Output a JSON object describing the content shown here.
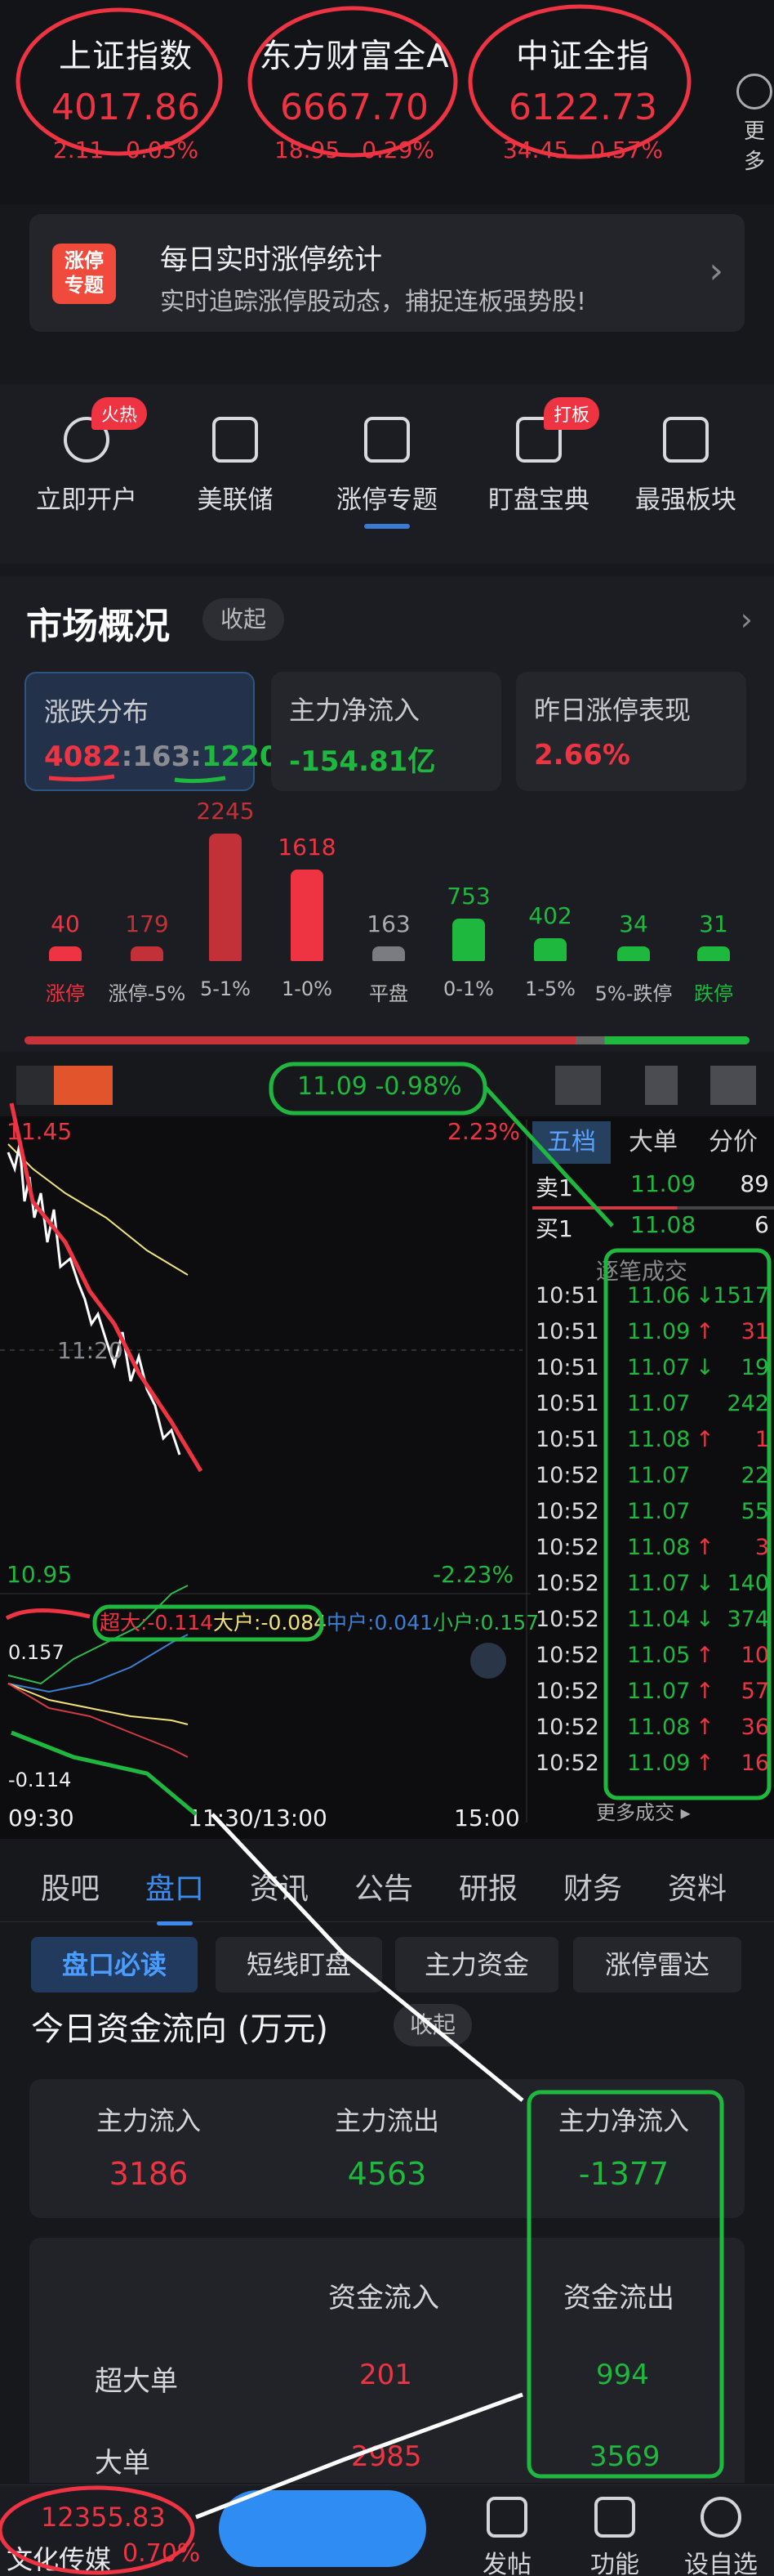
{
  "indices": [
    {
      "name": "上证指数",
      "value": "4017.86",
      "change": "2.11",
      "pct": "0.05%"
    },
    {
      "name": "东方财富全A",
      "value": "6667.70",
      "change": "18.95",
      "pct": "0.29%"
    },
    {
      "name": "中证全指",
      "value": "6122.73",
      "change": "34.45",
      "pct": "0.57%"
    }
  ],
  "more_label": "更多",
  "banner": {
    "logo_line1": "涨停",
    "logo_line2": "专题",
    "title": "每日实时涨停统计",
    "subtitle": "实时追踪涨停股动态，捕捉连板强势股!"
  },
  "shortcuts": [
    {
      "label": "立即开户",
      "badge": "火热",
      "icon": "user-add-icon"
    },
    {
      "label": "美联储",
      "badge": "",
      "icon": "bank-icon"
    },
    {
      "label": "涨停专题",
      "badge": "",
      "icon": "trend-up-icon"
    },
    {
      "label": "盯盘宝典",
      "badge": "打板",
      "icon": "candlestick-icon"
    },
    {
      "label": "最强板块",
      "badge": "",
      "icon": "grid-chart-icon"
    }
  ],
  "market": {
    "title": "市场概况",
    "collapse": "收起",
    "cards": [
      {
        "title": "涨跌分布",
        "up": "4082",
        "flat": "163",
        "down": "1220"
      },
      {
        "title": "主力净流入",
        "value": "-154.81亿"
      },
      {
        "title": "昨日涨停表现",
        "value": "2.66%"
      }
    ],
    "distribution": [
      {
        "label": "涨停",
        "value": 40,
        "color": "#ee3442"
      },
      {
        "label": "涨停-5%",
        "value": 179,
        "color": "#c23038"
      },
      {
        "label": "5-1%",
        "value": 2245,
        "color": "#c23038"
      },
      {
        "label": "1-0%",
        "value": 1618,
        "color": "#ee3442"
      },
      {
        "label": "平盘",
        "value": 163,
        "color": "#7a7c82"
      },
      {
        "label": "0-1%",
        "value": 753,
        "color": "#1fb83f"
      },
      {
        "label": "1-5%",
        "value": 402,
        "color": "#1fb83f"
      },
      {
        "label": "5%-跌停",
        "value": 34,
        "color": "#1fb83f"
      },
      {
        "label": "跌停",
        "value": 31,
        "color": "#1fb83f"
      }
    ]
  },
  "stock": {
    "price": "11.09",
    "pct": "-0.98%",
    "axis": {
      "high": "11.45",
      "mid": "11:20",
      "low": "10.95",
      "high_pct": "2.23%",
      "low_pct": "-2.23%"
    },
    "flow_labels": {
      "big": "超大:-0.114",
      "large": "大户:-0.084",
      "mid": "中户:0.041",
      "small": "小户:0.157",
      "top": "0.157",
      "bottom": "-0.114"
    },
    "time_axis": [
      "09:30",
      "11:30/13:00",
      "15:00"
    ],
    "panel_tabs": [
      "五档",
      "大单",
      "分价"
    ],
    "orderbook": [
      {
        "side": "卖1",
        "price": "11.09",
        "vol": "89"
      },
      {
        "side": "买1",
        "price": "11.08",
        "vol": "6"
      }
    ],
    "trades_title": "逐笔成交",
    "trades": [
      {
        "time": "10:51",
        "price": "11.06",
        "dir": "↓",
        "vol": "1517",
        "c": "g"
      },
      {
        "time": "10:51",
        "price": "11.09",
        "dir": "↑",
        "vol": "31",
        "c": "r"
      },
      {
        "time": "10:51",
        "price": "11.07",
        "dir": "↓",
        "vol": "19",
        "c": "g"
      },
      {
        "time": "10:51",
        "price": "11.07",
        "dir": "",
        "vol": "242",
        "c": "g"
      },
      {
        "time": "10:51",
        "price": "11.08",
        "dir": "↑",
        "vol": "1",
        "c": "r"
      },
      {
        "time": "10:52",
        "price": "11.07",
        "dir": "",
        "vol": "22",
        "c": "g"
      },
      {
        "time": "10:52",
        "price": "11.07",
        "dir": "",
        "vol": "55",
        "c": "g"
      },
      {
        "time": "10:52",
        "price": "11.08",
        "dir": "↑",
        "vol": "3",
        "c": "r"
      },
      {
        "time": "10:52",
        "price": "11.07",
        "dir": "↓",
        "vol": "140",
        "c": "g"
      },
      {
        "time": "10:52",
        "price": "11.04",
        "dir": "↓",
        "vol": "374",
        "c": "g"
      },
      {
        "time": "10:52",
        "price": "11.05",
        "dir": "↑",
        "vol": "10",
        "c": "r"
      },
      {
        "time": "10:52",
        "price": "11.07",
        "dir": "↑",
        "vol": "57",
        "c": "r"
      },
      {
        "time": "10:52",
        "price": "11.08",
        "dir": "↑",
        "vol": "36",
        "c": "r"
      },
      {
        "time": "10:52",
        "price": "11.09",
        "dir": "↑",
        "vol": "16",
        "c": "r"
      }
    ],
    "more_trades": "更多成交"
  },
  "tabs": [
    "股吧",
    "盘口",
    "资讯",
    "公告",
    "研报",
    "财务",
    "资料"
  ],
  "chips": [
    "盘口必读",
    "短线盯盘",
    "主力资金",
    "涨停雷达"
  ],
  "fundflow": {
    "title": "今日资金流向 (万元)",
    "collapse": "收起",
    "summary": [
      {
        "label": "主力流入",
        "value": "3186"
      },
      {
        "label": "主力流出",
        "value": "4563"
      },
      {
        "label": "主力净流入",
        "value": "-1377"
      }
    ],
    "headers": [
      "资金流入",
      "资金流出"
    ],
    "rows": [
      {
        "label": "超大单",
        "in": "201",
        "out": "994"
      },
      {
        "label": "大单",
        "in": "2985",
        "out": "3569"
      }
    ]
  },
  "bottom": {
    "price": "12355.83",
    "name": "文化传媒",
    "pct": "0.70%",
    "actions": [
      "发帖",
      "功能",
      "设自选"
    ]
  }
}
